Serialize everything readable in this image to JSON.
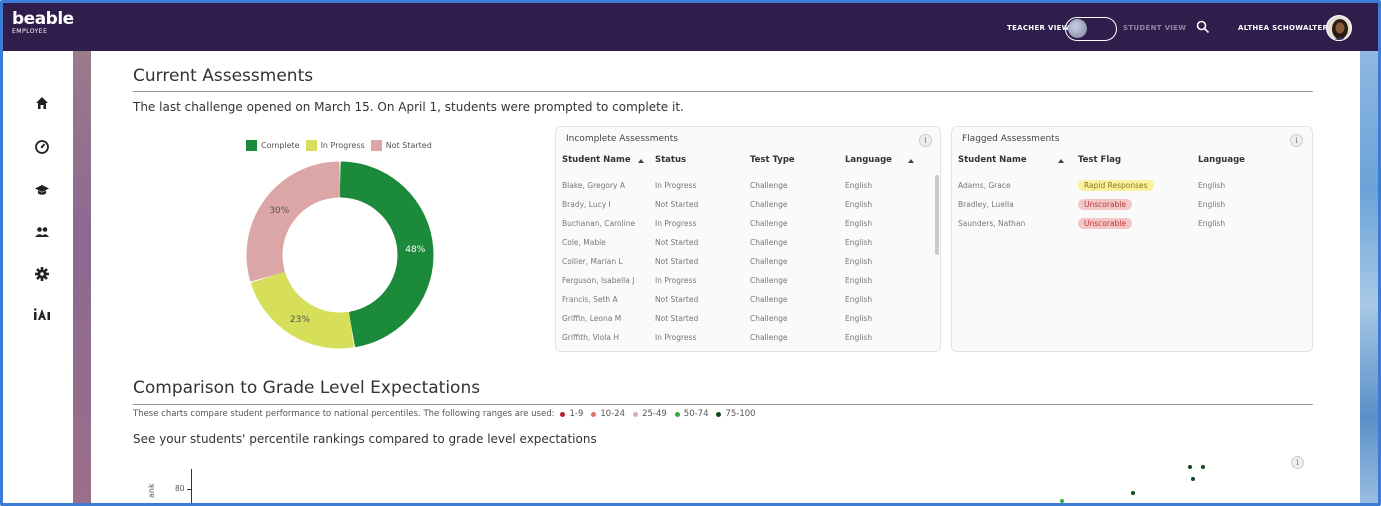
{
  "brand": {
    "logo": "beable",
    "sub": "EMPLOYEE"
  },
  "header": {
    "teacher_view": "TEACHER VIEW",
    "student_view": "STUDENT VIEW",
    "user_name": "ALTHEA SCHOWALTER"
  },
  "icons": {
    "nav": [
      "home-icon",
      "dashboard-icon",
      "graduation-cap-icon",
      "users-icon",
      "settings-icon",
      "ai-icon"
    ],
    "header": [
      "search-icon",
      "avatar"
    ]
  },
  "current": {
    "title": "Current Assessments",
    "lead": "The last challenge opened on March 15. On April 1, students were prompted to complete it."
  },
  "chart_data": {
    "type": "pie",
    "legend": [
      "Complete",
      "In Progress",
      "Not Started"
    ],
    "colors": [
      "#1b8a3a",
      "#d6de5a",
      "#dca6a6"
    ],
    "values": [
      48,
      23,
      30
    ],
    "labels": [
      "48%",
      "23%",
      "30%"
    ]
  },
  "incomplete": {
    "title": "Incomplete Assessments",
    "info": "i",
    "headers": [
      "Student Name",
      "Status",
      "Test Type",
      "Language"
    ],
    "rows": [
      [
        "Blake, Gregory A",
        "In Progress",
        "Challenge",
        "English"
      ],
      [
        "Brady, Lucy I",
        "Not Started",
        "Challenge",
        "English"
      ],
      [
        "Buchanan, Caroline",
        "In Progress",
        "Challenge",
        "English"
      ],
      [
        "Cole, Mable",
        "Not Started",
        "Challenge",
        "English"
      ],
      [
        "Collier, Marian L",
        "Not Started",
        "Challenge",
        "English"
      ],
      [
        "Ferguson, Isabella J",
        "In Progress",
        "Challenge",
        "English"
      ],
      [
        "Francis, Seth A",
        "Not Started",
        "Challenge",
        "English"
      ],
      [
        "Griffin, Leona M",
        "Not Started",
        "Challenge",
        "English"
      ],
      [
        "Griffith, Viola H",
        "In Progress",
        "Challenge",
        "English"
      ]
    ]
  },
  "flagged": {
    "title": "Flagged Assessments",
    "info": "i",
    "headers": [
      "Student Name",
      "Test Flag",
      "Language"
    ],
    "rows": [
      [
        "Adams, Grace",
        "Rapid Responses",
        "English"
      ],
      [
        "Bradley, Luella",
        "Unscorable",
        "English"
      ],
      [
        "Saunders, Nathan",
        "Unscorable",
        "English"
      ]
    ],
    "flag_colors": [
      "#fbf0a0",
      "#f5c6c6",
      "#f5c6c6"
    ]
  },
  "comparison": {
    "title": "Comparison to Grade Level Expectations",
    "ranges_intro": "These charts compare student performance to national percentiles. The following ranges are used:",
    "ranges": [
      {
        "label": "1-9",
        "color": "#b02424"
      },
      {
        "label": "10-24",
        "color": "#e07070"
      },
      {
        "label": "25-49",
        "color": "#e8a8b0"
      },
      {
        "label": "50-74",
        "color": "#2fae3a"
      },
      {
        "label": "75-100",
        "color": "#0f4a1c"
      }
    ],
    "subtitle": "See your students' percentile rankings compared to grade level expectations",
    "y_tick": "80",
    "y_axis_label": "ank",
    "info": "i"
  }
}
